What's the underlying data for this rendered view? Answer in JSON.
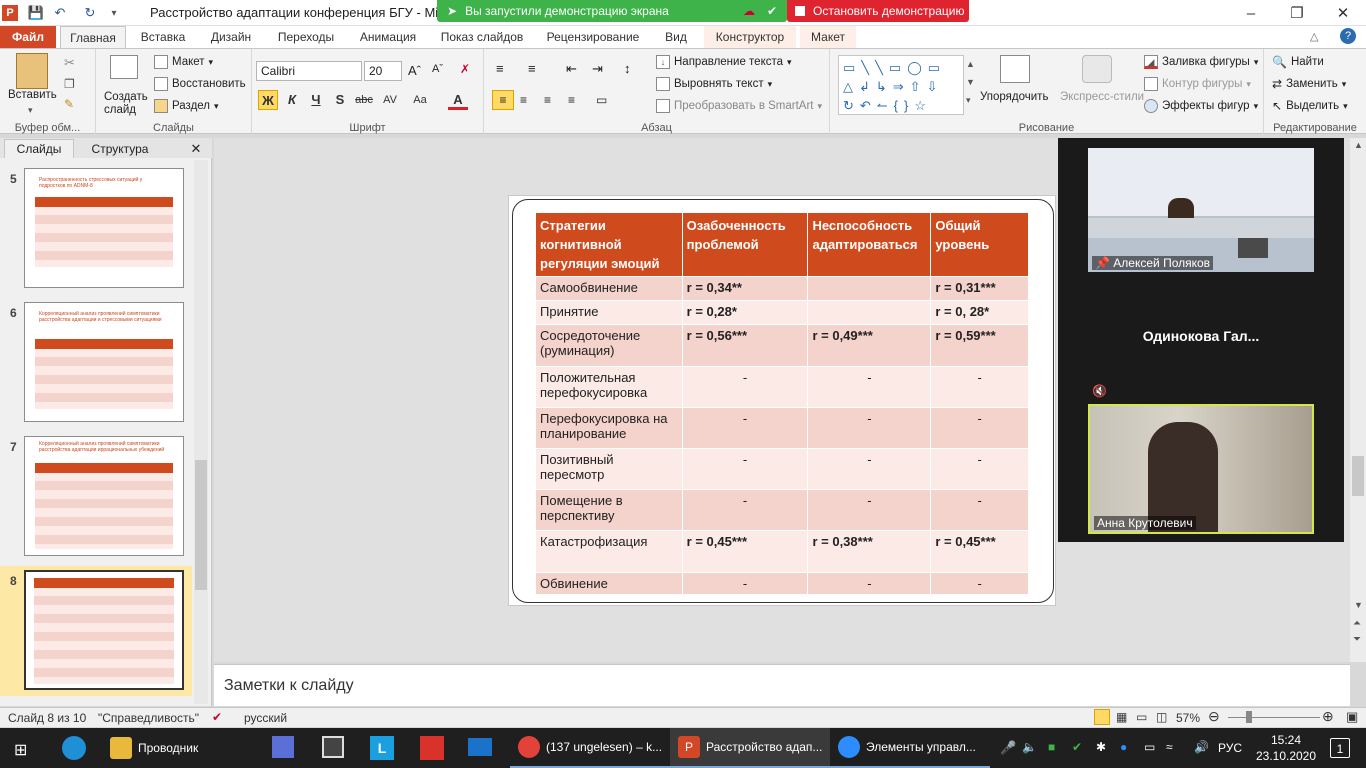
{
  "window": {
    "title": "Расстройство адаптации конференция БГУ - Micros",
    "share_notice": "Вы запустили демонстрацию экрана",
    "stop_share": "Остановить демонстрацию"
  },
  "ribbon_tabs": [
    "Файл",
    "Главная",
    "Вставка",
    "Дизайн",
    "Переходы",
    "Анимация",
    "Показ слайдов",
    "Рецензирование",
    "Вид",
    "Конструктор",
    "Макет"
  ],
  "ribbon": {
    "clipboard": {
      "paste": "Вставить",
      "label": "Буфер обм..."
    },
    "slides": {
      "create": "Создать слайд",
      "layout": "Макет",
      "reset": "Восстановить",
      "section": "Раздел",
      "label": "Слайды"
    },
    "font": {
      "name": "Calibri",
      "size": "20",
      "label": "Шрифт",
      "bold": "Ж",
      "italic": "К",
      "underline": "Ч",
      "shadow": "S",
      "strike": "abc",
      "spacing": "AV",
      "case": "Aa",
      "color": "A"
    },
    "paragraph": {
      "text_direction": "Направление текста",
      "align_text": "Выровнять текст",
      "smartart": "Преобразовать в SmartArt",
      "label": "Абзац"
    },
    "drawing": {
      "arrange": "Упорядочить",
      "quick_styles": "Экспресс-стили",
      "fill": "Заливка фигуры",
      "outline": "Контур фигуры",
      "effects": "Эффекты фигур",
      "label": "Рисование"
    },
    "editing": {
      "find": "Найти",
      "replace": "Заменить",
      "select": "Выделить",
      "label": "Редактирование"
    }
  },
  "left_panel": {
    "tab_slides": "Слайды",
    "tab_outline": "Структура",
    "thumbs": [
      {
        "num": "5",
        "title": "Распространенность стрессовых ситуаций у подростков по ADNM-8"
      },
      {
        "num": "6",
        "title": "Корреляционный анализ проявлений симптоматики расстройства адаптации и стрессовыми ситуациями"
      },
      {
        "num": "7",
        "title": "Корреляционный анализ проявлений симптоматики расстройства адаптации иррациональных убеждений"
      },
      {
        "num": "8",
        "title": ""
      }
    ]
  },
  "slide_table": {
    "headers": [
      "Стратегии когнитивной регуляции эмоций",
      "Озабоченность проблемой",
      "Неспособность адаптироваться",
      "Общий уровень"
    ],
    "rows": [
      [
        "Самообвинение",
        "r = 0,34**",
        "",
        "r = 0,31***"
      ],
      [
        "Принятие",
        "r = 0,28*",
        "",
        "r = 0, 28*"
      ],
      [
        "Сосредоточение (руминация)",
        "r = 0,56***",
        "r = 0,49***",
        "r = 0,59***"
      ],
      [
        "Положительная перефокусировка",
        "-",
        "-",
        "-"
      ],
      [
        "Перефокусировка на планирование",
        "-",
        "-",
        "-"
      ],
      [
        "Позитивный пересмотр",
        "-",
        "-",
        "-"
      ],
      [
        "Помещение в перспективу",
        "-",
        "-",
        "-"
      ],
      [
        "Катастрофизация",
        "r = 0,45***",
        "r = 0,38***",
        "r = 0,45***"
      ],
      [
        "Обвинение",
        "-",
        "-",
        "-"
      ]
    ]
  },
  "zoom": {
    "p1": "Алексей Поляков",
    "p2": "Одинокова  Гал...",
    "p3": "Анна Крутолевич"
  },
  "notes_placeholder": "Заметки к слайду",
  "status": {
    "slide_of": "Слайд 8 из 10",
    "theme": "\"Справедливость\"",
    "language": "русский",
    "zoom": "57%"
  },
  "taskbar": {
    "explorer": "Проводник",
    "chrome": "(137 ungelesen) – k...",
    "powerpoint": "Расстройство адап...",
    "zoom": "Элементы управл...",
    "lang": "РУС",
    "time": "15:24",
    "date": "23.10.2020",
    "notif": "1"
  }
}
